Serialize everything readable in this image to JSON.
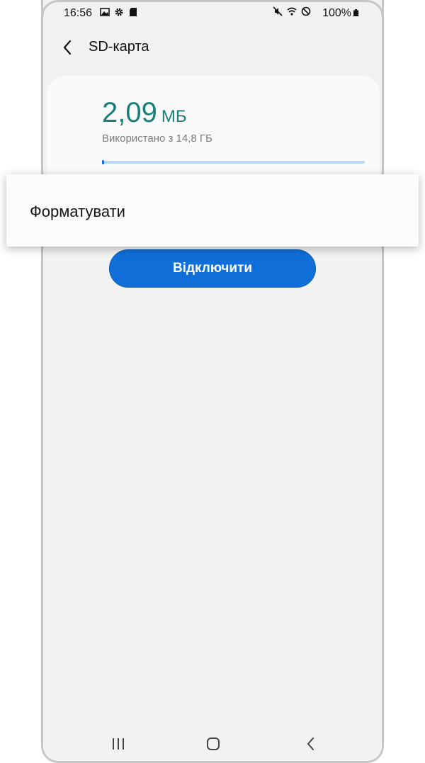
{
  "status_bar": {
    "time": "16:56",
    "battery_percent": "100%",
    "left_icons": [
      "image-icon",
      "gear-icon",
      "sd-card-icon"
    ],
    "right_icons": [
      "mute-icon",
      "wifi-icon",
      "do-not-disturb-icon",
      "battery-icon"
    ]
  },
  "header": {
    "title": "SD-карта",
    "back_icon": "chevron-left-icon"
  },
  "storage": {
    "used_value": "2,09",
    "used_unit": "МБ",
    "used_of": "Використано з 14,8 ГБ",
    "used_fraction": 0.0001,
    "accent_color": "#1a7f7a",
    "bar_color": "#0b6ed0"
  },
  "popup_menu": {
    "items": [
      {
        "label": "Форматувати"
      }
    ]
  },
  "actions": {
    "disconnect_label": "Відключити",
    "button_color": "#0f6ed7"
  },
  "nav_bar": {
    "icons": [
      "recents-icon",
      "home-icon",
      "back-icon"
    ]
  }
}
